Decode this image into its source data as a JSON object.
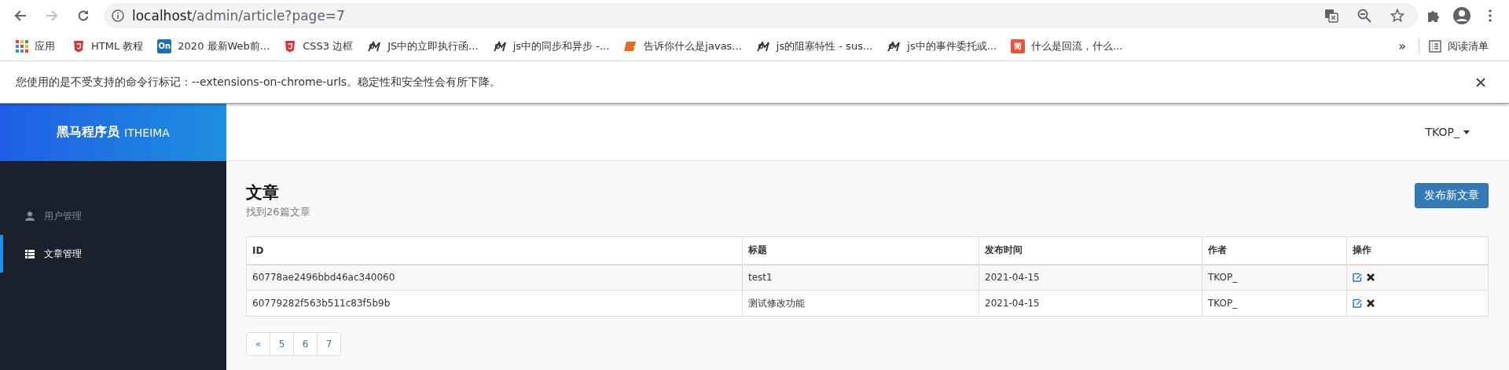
{
  "browser": {
    "address": {
      "host": "localhost",
      "path": "/admin/article?page=7"
    },
    "bookmarks": [
      {
        "label": "应用",
        "kind": "apps"
      },
      {
        "label": "HTML 教程",
        "kind": "shield"
      },
      {
        "label": "2020 最新Web前...",
        "kind": "badge",
        "badge": "On",
        "color": "#1e6fb8"
      },
      {
        "label": "CSS3 边框",
        "kind": "shield"
      },
      {
        "label": "JS中的立即执行函...",
        "kind": "bird"
      },
      {
        "label": "js中的同步和异步 -...",
        "kind": "bird"
      },
      {
        "label": "告诉你什么是javas...",
        "kind": "jb"
      },
      {
        "label": "js的阻塞特性 - sus...",
        "kind": "bird"
      },
      {
        "label": "js中的事件委托或...",
        "kind": "bird"
      },
      {
        "label": "什么是回流，什么...",
        "kind": "badge",
        "badge": "简",
        "color": "#e8553e"
      }
    ],
    "overflow": "»",
    "reading_list": "阅读清单",
    "infobar": {
      "message": "您使用的是不受支持的命令行标记：--extensions-on-chrome-urls。稳定性和安全性会有所下降。"
    }
  },
  "app": {
    "logo": {
      "name": "黑马程序员",
      "sub": "ITHEIMA"
    },
    "sidebar": {
      "items": [
        {
          "label": "用户管理",
          "kind": "user",
          "selected": false
        },
        {
          "label": "文章管理",
          "kind": "list",
          "selected": true
        }
      ]
    },
    "user_menu": "TKOP_",
    "page": {
      "title": "文章",
      "subtitle": "找到26篇文章",
      "button": "发布新文章"
    },
    "table": {
      "columns": [
        "ID",
        "标题",
        "发布时间",
        "作者",
        "操作"
      ],
      "rows": [
        {
          "cells": [
            "60778ae2496bbd46ac340060",
            "test1",
            "2021-04-15",
            "TKOP_"
          ]
        },
        {
          "cells": [
            "60779282f563b511c83f5b9b",
            "测试修改功能",
            "2021-04-15",
            "TKOP_"
          ]
        }
      ]
    },
    "pagination": [
      "«",
      "5",
      "6",
      "7"
    ]
  }
}
